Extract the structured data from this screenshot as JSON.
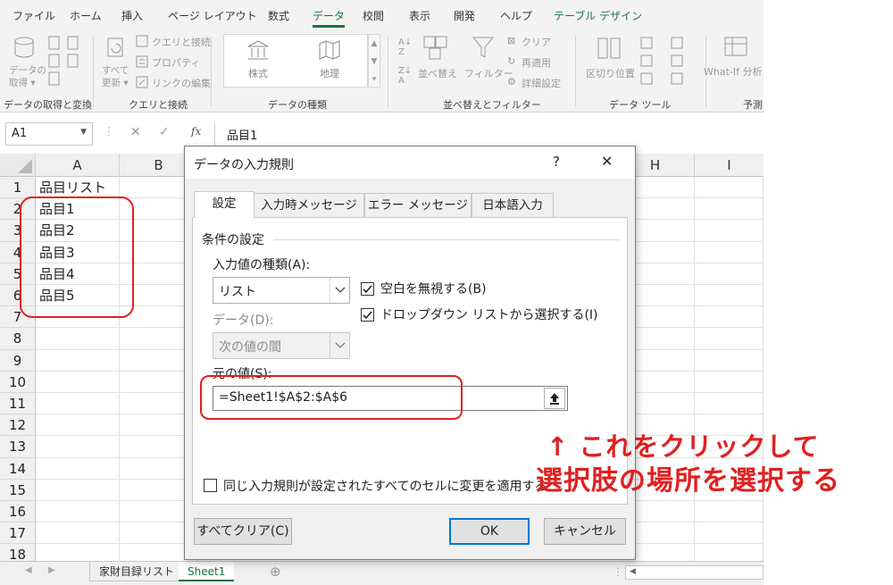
{
  "menu": {
    "items": [
      "ファイル",
      "ホーム",
      "挿入",
      "ページ レイアウト",
      "数式",
      "データ",
      "校閲",
      "表示",
      "開発",
      "ヘルプ",
      "テーブル デザイン"
    ],
    "active": "データ"
  },
  "ribbon": {
    "groups": {
      "get_transform": "データの取得と変換",
      "queries": "クエリと接続",
      "types": "データの種類",
      "sort_filter": "並べ替えとフィルター",
      "tools": "データ ツール",
      "forecast": "予測"
    },
    "buttons": {
      "get_data": "データの\n取得 ▾",
      "refresh_all": "すべて\n更新 ▾",
      "queries_connections": "クエリと接続",
      "properties": "プロパティ",
      "edit_links": "リンクの編集",
      "stocks": "株式",
      "geography": "地理",
      "sort": "並べ替え",
      "filter": "フィルター",
      "clear": "クリア",
      "reapply": "再適用",
      "advanced": "詳細設定",
      "text_to_columns": "区切り位置",
      "whatif": "What-If 分析"
    }
  },
  "formula_bar": {
    "name_box": "A1",
    "fx": "fx",
    "formula": "品目1"
  },
  "grid": {
    "columns": [
      "A",
      "B",
      "H",
      "I"
    ],
    "rows": [
      "1",
      "2",
      "3",
      "4",
      "5",
      "6",
      "7",
      "8",
      "9",
      "10",
      "11",
      "12",
      "13",
      "14",
      "15",
      "16",
      "17",
      "18"
    ],
    "cells_a": [
      "品目リスト",
      "品目1",
      "品目2",
      "品目3",
      "品目4",
      "品目5"
    ]
  },
  "sheets": {
    "tabs": [
      "家財目録リスト",
      "Sheet1"
    ],
    "active": "Sheet1"
  },
  "dialog": {
    "title": "データの入力規則",
    "help": "?",
    "close": "✕",
    "tabs": [
      "設定",
      "入力時メッセージ",
      "エラー メッセージ",
      "日本語入力"
    ],
    "section": "条件の設定",
    "allow_label": "入力値の種類(A):",
    "allow_value": "リスト",
    "data_label": "データ(D):",
    "data_value": "次の値の間",
    "ignore_blank": "空白を無視する(B)",
    "dropdown": "ドロップダウン リストから選択する(I)",
    "source_label": "元の値(S):",
    "source_value": "=Sheet1!$A$2:$A$6",
    "apply_all": "同じ入力規則が設定されたすべてのセルに変更を適用する",
    "clear_all": "すべてクリア(C)",
    "ok": "OK",
    "cancel": "キャンセル"
  },
  "annotation": {
    "line1": "↑ これをクリックして",
    "line2": "選択肢の場所を選択する",
    "color": "#e02020"
  }
}
